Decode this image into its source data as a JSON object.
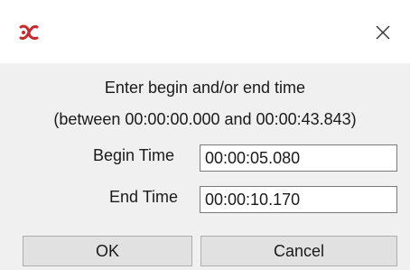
{
  "window": {
    "icon": "app-logo-icon",
    "close_icon": "close-icon"
  },
  "dialog": {
    "prompt": "Enter begin and/or end time",
    "range_text": "(between 00:00:00.000 and 00:00:43.843)",
    "begin_label": "Begin Time",
    "begin_value": "00:00:05.080",
    "end_label": "End Time",
    "end_value": "00:00:10.170",
    "ok_label": "OK",
    "cancel_label": "Cancel"
  },
  "colors": {
    "accent": "#c8282e",
    "background": "#f0f0f0",
    "button": "#e1e1e1"
  }
}
